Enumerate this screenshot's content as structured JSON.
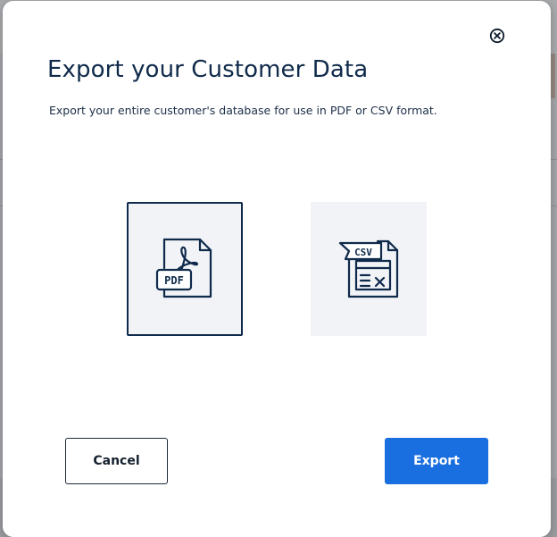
{
  "modal": {
    "title": "Export your Customer Data",
    "subtitle": "Export your entire customer's database for use in PDF or CSV format.",
    "close_icon": "close-circle-icon"
  },
  "options": [
    {
      "id": "pdf",
      "label": "PDF",
      "icon": "pdf-file-icon",
      "selected": true
    },
    {
      "id": "csv",
      "label": "CSV",
      "icon": "csv-file-icon",
      "selected": false
    }
  ],
  "buttons": {
    "cancel_label": "Cancel",
    "export_label": "Export"
  },
  "colors": {
    "title": "#0f2a4a",
    "accent": "#1a6fe0",
    "option_bg": "#f1f3f7",
    "icon_stroke": "#0f2a4a"
  }
}
